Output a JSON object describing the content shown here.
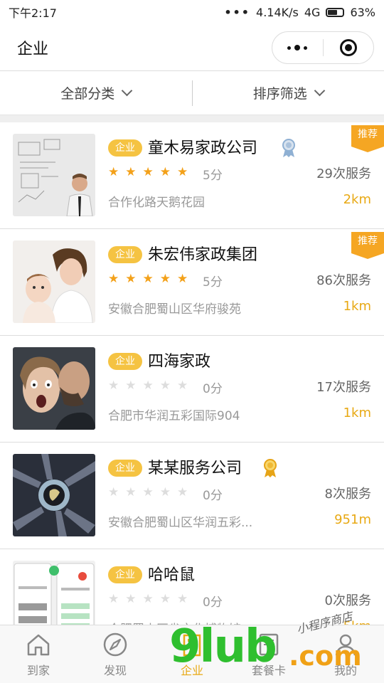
{
  "status": {
    "time": "下午2:17",
    "signal_dots": "•••",
    "speed": "4.14K/s",
    "network": "4G",
    "battery": "63%"
  },
  "navbar": {
    "title": "企业",
    "menu_icon": "more-dots-icon",
    "close_icon": "target-circle-icon"
  },
  "filters": {
    "category": "全部分类",
    "sort": "排序筛选"
  },
  "companies": [
    {
      "tag": "企业",
      "name": "童木易家政公司",
      "stars": 5,
      "score": "5分",
      "services": "29次服务",
      "address": "合作化路天鹅花园",
      "distance": "2km",
      "recommend": "推荐",
      "medal": "silver"
    },
    {
      "tag": "企业",
      "name": "朱宏伟家政集团",
      "stars": 5,
      "score": "5分",
      "services": "86次服务",
      "address": "安徽合肥蜀山区华府骏苑",
      "distance": "1km",
      "recommend": "推荐"
    },
    {
      "tag": "企业",
      "name": "四海家政",
      "stars": 0,
      "score": "0分",
      "services": "17次服务",
      "address": "合肥市华润五彩国际904",
      "distance": "1km"
    },
    {
      "tag": "企业",
      "name": "某某服务公司",
      "stars": 0,
      "score": "0分",
      "services": "8次服务",
      "address": "安徽合肥蜀山区华润五彩...",
      "distance": "951m",
      "medal": "gold"
    },
    {
      "tag": "企业",
      "name": "哈哈鼠",
      "stars": 0,
      "score": "0分",
      "services": "0次服务",
      "address": "合肥蜀山区省文化博物馆",
      "distance": "5km"
    }
  ],
  "tabs": [
    {
      "label": "到家",
      "icon": "home-icon"
    },
    {
      "label": "发现",
      "icon": "compass-icon"
    },
    {
      "label": "企业",
      "icon": "building-icon",
      "active": true
    },
    {
      "label": "套餐卡",
      "icon": "card-icon"
    },
    {
      "label": "我的",
      "icon": "user-icon"
    }
  ],
  "watermark": {
    "brand": "9lub",
    "domain": ".com",
    "tagline": "小程序商店"
  },
  "colors": {
    "accent": "#e8a914",
    "badge": "#f5c342",
    "recommend": "#f5a623",
    "star_on": "#f3a11a",
    "star_off": "#dddddd"
  }
}
